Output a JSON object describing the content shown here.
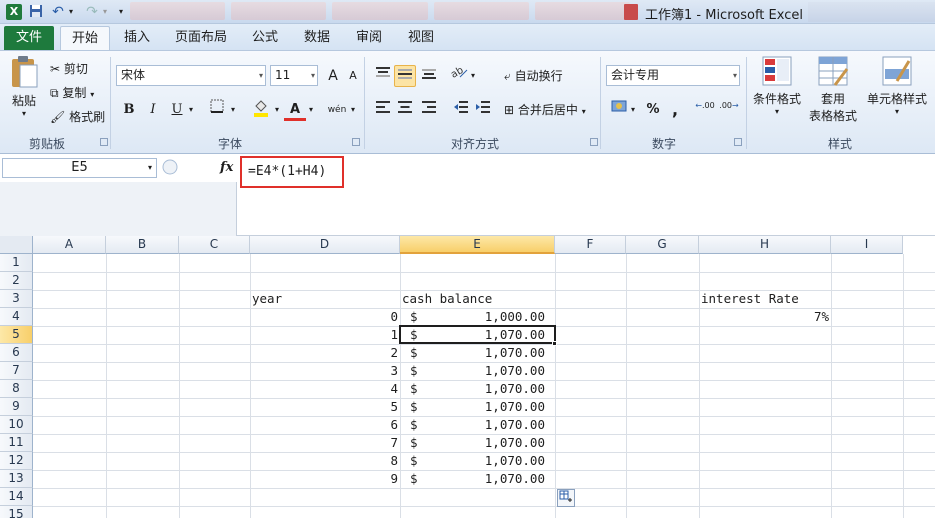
{
  "window": {
    "title": "工作簿1 - Microsoft Excel"
  },
  "quick_access": {
    "logo": "X",
    "save": "💾",
    "undo": "↶",
    "redo": "↷",
    "dropdown": "▾"
  },
  "tabs": [
    {
      "label": "文件"
    },
    {
      "label": "开始"
    },
    {
      "label": "插入"
    },
    {
      "label": "页面布局"
    },
    {
      "label": "公式"
    },
    {
      "label": "数据"
    },
    {
      "label": "审阅"
    },
    {
      "label": "视图"
    }
  ],
  "ribbon": {
    "clipboard": {
      "group": "剪贴板",
      "paste": "粘贴",
      "cut": "剪切",
      "copy": "复制",
      "format_painter": "格式刷"
    },
    "font": {
      "group": "字体",
      "name": "宋体",
      "size": "11",
      "bold": "B",
      "italic": "I",
      "underline": "U",
      "grow": "A",
      "shrink": "A",
      "font_color": "A",
      "phonetic": "wén"
    },
    "alignment": {
      "group": "对齐方式",
      "wrap": "自动换行",
      "merge": "合并后居中"
    },
    "number": {
      "group": "数字",
      "format": "会计专用",
      "percent": "%",
      "comma": ",",
      "inc_dec": ".00",
      "dec_dec": ".00"
    },
    "styles": {
      "group": "样式",
      "conditional": "条件格式",
      "table_line1": "套用",
      "table_line2": "表格格式",
      "cell_styles": "单元格样式"
    }
  },
  "formula_bar": {
    "name_box": "E5",
    "fx": "fx",
    "formula": "=E4*(1+H4)"
  },
  "sheet": {
    "columns": [
      "A",
      "B",
      "C",
      "D",
      "E",
      "F",
      "G",
      "H",
      "I"
    ],
    "rows": [
      "1",
      "2",
      "3",
      "4",
      "5",
      "6",
      "7",
      "8",
      "9",
      "10",
      "11",
      "12",
      "13",
      "14",
      "15"
    ],
    "selected_column": "E",
    "selected_row": "5",
    "headers": {
      "year": "year",
      "cash_balance": "cash balance",
      "interest_rate": "interest Rate"
    },
    "interest_rate_value": "7%",
    "data_rows": [
      {
        "year": "0",
        "currency": "$",
        "amount": "1,000.00"
      },
      {
        "year": "1",
        "currency": "$",
        "amount": "1,070.00"
      },
      {
        "year": "2",
        "currency": "$",
        "amount": "1,070.00"
      },
      {
        "year": "3",
        "currency": "$",
        "amount": "1,070.00"
      },
      {
        "year": "4",
        "currency": "$",
        "amount": "1,070.00"
      },
      {
        "year": "5",
        "currency": "$",
        "amount": "1,070.00"
      },
      {
        "year": "6",
        "currency": "$",
        "amount": "1,070.00"
      },
      {
        "year": "7",
        "currency": "$",
        "amount": "1,070.00"
      },
      {
        "year": "8",
        "currency": "$",
        "amount": "1,070.00"
      },
      {
        "year": "9",
        "currency": "$",
        "amount": "1,070.00"
      }
    ]
  },
  "colors": {
    "accent_file_tab": "#1e7a3d",
    "highlight_box": "#e0302a",
    "selected_header": "#f8cf6a"
  }
}
